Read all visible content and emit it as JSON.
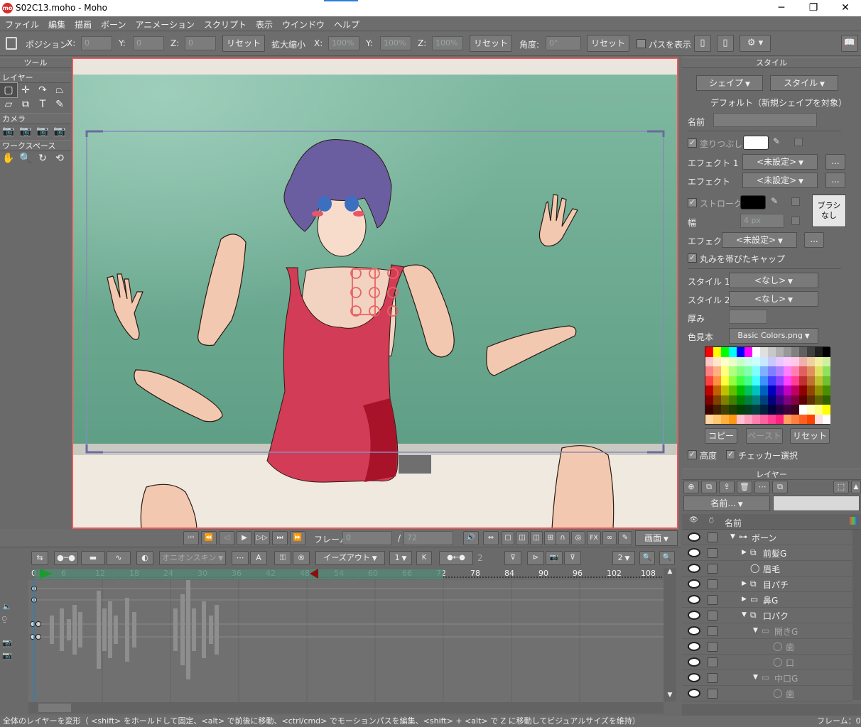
{
  "window": {
    "title": "S02C13.moho - Moho",
    "logo": "mo",
    "min": "─",
    "max": "❐",
    "close": "✕"
  },
  "menu": [
    "ファイル",
    "編集",
    "描画",
    "ボーン",
    "アニメーション",
    "スクリプト",
    "表示",
    "ウインドウ",
    "ヘルプ"
  ],
  "toolbar": {
    "position_label": "ポジション",
    "x_label": "X:",
    "x_value": "0",
    "y_label": "Y:",
    "y_value": "0",
    "z_label": "Z:",
    "z_value": "0",
    "reset1": "リセット",
    "scale_label": "拡大縮小",
    "sx_label": "X:",
    "sx_value": "100%",
    "sy_label": "Y:",
    "sy_value": "100%",
    "sz_label": "Z:",
    "sz_value": "100%",
    "reset2": "リセット",
    "angle_label": "角度:",
    "angle_value": "0°",
    "reset3": "リセット",
    "show_path": "パスを表示"
  },
  "tools": {
    "title": "ツール",
    "layer_label": "レイヤー",
    "camera_label": "カメラ",
    "workspace_label": "ワークスペース"
  },
  "style_panel": {
    "title": "スタイル",
    "shape_dd": "シェイプ",
    "style_dd": "スタイル",
    "default_label": "デフォルト（新規シェイプを対象）",
    "name_label": "名前",
    "fill_label": "塗りつぶし",
    "effect1_label": "エフェクト 1",
    "effect1_value": "<未設定>",
    "effect2_label": "エフェクト",
    "effect2_value": "<未設定>",
    "more": "...",
    "stroke_label": "ストローク",
    "brush_label": "ブラシ\nなし",
    "width_label": "幅",
    "width_value": "4 px",
    "effect3_label": "エフェクト",
    "effect3_value": "<未設定>",
    "round_caps": "丸みを帯びたキャップ",
    "style1_label": "スタイル 1",
    "style1_value": "<なし>",
    "style2_label": "スタイル 2",
    "style2_value": "<なし>",
    "thickness_label": "厚み",
    "swatch_label": "色見本",
    "swatch_value": "Basic Colors.png",
    "copy": "コピー",
    "paste": "ペースト",
    "reset": "リセット",
    "advanced": "高度",
    "checker": "チェッカー選択",
    "fill_color": "#ffffff",
    "stroke_color": "#000000"
  },
  "layers_panel": {
    "title": "レイヤー",
    "name_dd": "名前...",
    "col_name": "名前",
    "rows": [
      {
        "name": "ボーン",
        "indent": 0,
        "arrow": "▼",
        "icon": "bone-icon",
        "dim": false
      },
      {
        "name": "前髪G",
        "indent": 1,
        "arrow": "▶",
        "icon": "switch-folder-icon",
        "dim": false
      },
      {
        "name": "眉毛",
        "indent": 1,
        "arrow": "",
        "icon": "vector-icon",
        "dim": false
      },
      {
        "name": "目パチ",
        "indent": 1,
        "arrow": "▶",
        "icon": "switch-folder-icon",
        "dim": false
      },
      {
        "name": "鼻G",
        "indent": 1,
        "arrow": "▶",
        "icon": "folder-icon",
        "dim": false
      },
      {
        "name": "口パク",
        "indent": 1,
        "arrow": "▼",
        "icon": "switch-folder-icon",
        "dim": false
      },
      {
        "name": "開きG",
        "indent": 2,
        "arrow": "▼",
        "icon": "folder-icon",
        "dim": true
      },
      {
        "name": "歯",
        "indent": 3,
        "arrow": "",
        "icon": "vector-icon",
        "dim": true
      },
      {
        "name": "口",
        "indent": 3,
        "arrow": "",
        "icon": "vector-icon",
        "dim": true
      },
      {
        "name": "中口G",
        "indent": 2,
        "arrow": "▼",
        "icon": "folder-icon",
        "dim": true
      },
      {
        "name": "歯",
        "indent": 3,
        "arrow": "",
        "icon": "vector-icon",
        "dim": true
      }
    ]
  },
  "playback": {
    "frame_label": "フレーム",
    "frame_value": "0",
    "total_sep": "/",
    "total": "72",
    "view_dd": "画面"
  },
  "timeline": {
    "onion": "オニオンスキン",
    "ease": "イーズアウト",
    "num1": "1",
    "k": "K",
    "num2": "2",
    "zoom": "2",
    "ruler": [
      "0",
      "6",
      "12",
      "18",
      "24",
      "30",
      "36",
      "42",
      "48",
      "54",
      "60",
      "66",
      "72",
      "78",
      "84",
      "90",
      "96",
      "102",
      "108"
    ]
  },
  "status": {
    "text": "全体のレイヤーを変形（ <shift> をホールドして固定、<alt> で前後に移動、<ctrl/cmd> でモーションパスを編集、<shift> + <alt> で Z に移動してビジュアルサイズを維持）",
    "frame": "フレーム：0"
  }
}
